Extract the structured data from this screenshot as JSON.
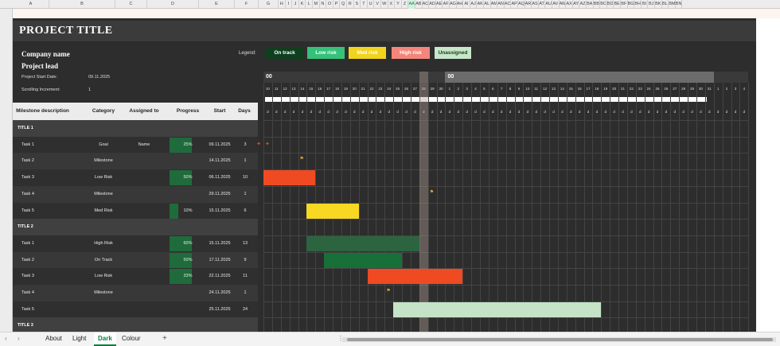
{
  "column_headers": [
    "A",
    "B",
    "C",
    "D",
    "E",
    "F",
    "G",
    "H",
    "I",
    "J",
    "K",
    "L",
    "M",
    "N",
    "O",
    "P",
    "Q",
    "R",
    "S",
    "T",
    "U",
    "V",
    "W",
    "X",
    "Y",
    "Z",
    "AA",
    "AB",
    "AC",
    "AD",
    "AE",
    "AF",
    "AG",
    "AH",
    "AI",
    "AJ",
    "AK",
    "AL",
    "AM",
    "AN",
    "AO",
    "AP",
    "AQ",
    "AR",
    "AS",
    "AT",
    "AU",
    "AV",
    "AW",
    "AX",
    "AY",
    "AZ",
    "BA",
    "BB",
    "BC",
    "BD",
    "BE",
    "BF",
    "BG",
    "BH",
    "BI",
    "BJ",
    "BK",
    "BL",
    "BM",
    "BN"
  ],
  "sheet": {
    "title": "PROJECT TITLE",
    "company": "Company name",
    "project_lead": "Project lead",
    "start_label": "Project Start Date:",
    "start_value": "09.11.2025",
    "scroll_label": "Scrolling Increment:",
    "scroll_value": "1"
  },
  "legend": {
    "label": "Legend:",
    "items": [
      {
        "label": "On track",
        "bg": "#0f3f1f",
        "fg": "#ffffff"
      },
      {
        "label": "Low risk",
        "bg": "#36c17a",
        "fg": "#ffffff"
      },
      {
        "label": "Med risk",
        "bg": "#f2d41f",
        "fg": "#ffffff"
      },
      {
        "label": "High risk",
        "bg": "#f3857a",
        "fg": "#ffffff"
      },
      {
        "label": "Unassigned",
        "bg": "#c8e6c9",
        "fg": "#1a3a1a"
      }
    ]
  },
  "table_headers": {
    "milestone": "Milestone description",
    "category": "Category",
    "assigned": "Assigned to",
    "progress": "Progress",
    "start": "Start",
    "days": "Days"
  },
  "rows": [
    {
      "type": "title",
      "name": "TITLE 1"
    },
    {
      "type": "task",
      "name": "Task 1",
      "category": "Goal",
      "assigned": "Name",
      "progress": "25%",
      "progress_frac": 0.25,
      "start": "09.11.2025",
      "days": "3",
      "marker": "star"
    },
    {
      "type": "task",
      "name": "Task 2",
      "category": "Milestone",
      "assigned": "",
      "progress": "",
      "progress_frac": 0,
      "start": "14.11.2025",
      "days": "1",
      "marker": "flag"
    },
    {
      "type": "task",
      "name": "Task 3",
      "category": "Low Risk",
      "assigned": "",
      "progress": "50%",
      "progress_frac": 0.5,
      "start": "06.11.2025",
      "days": "10",
      "marker": "bar",
      "color": "#f04a23"
    },
    {
      "type": "task",
      "name": "Task 4",
      "category": "Milestone",
      "assigned": "",
      "progress": "",
      "progress_frac": 0,
      "start": "29.11.2025",
      "days": "1",
      "marker": "flag"
    },
    {
      "type": "task",
      "name": "Task 5",
      "category": "Med Risk",
      "assigned": "",
      "progress": "10%",
      "progress_frac": 0.1,
      "start": "15.11.2025",
      "days": "6",
      "marker": "bar",
      "color": "#f8d823"
    },
    {
      "type": "title",
      "name": "TITLE 2"
    },
    {
      "type": "task",
      "name": "Task 1",
      "category": "High Risk",
      "assigned": "",
      "progress": "60%",
      "progress_frac": 0.6,
      "start": "15.11.2025",
      "days": "13",
      "marker": "bar",
      "color": "#2d6440"
    },
    {
      "type": "task",
      "name": "Task 2",
      "category": "On Track",
      "assigned": "",
      "progress": "50%",
      "progress_frac": 0.5,
      "start": "17.11.2025",
      "days": "9",
      "marker": "bar",
      "color": "#167038"
    },
    {
      "type": "task",
      "name": "Task 3",
      "category": "Low Risk",
      "assigned": "",
      "progress": "33%",
      "progress_frac": 0.33,
      "start": "22.11.2025",
      "days": "11",
      "marker": "bar",
      "color": "#f04a23"
    },
    {
      "type": "task",
      "name": "Task 4",
      "category": "Milestone",
      "assigned": "",
      "progress": "",
      "progress_frac": 0,
      "start": "24.11.2025",
      "days": "1",
      "marker": "flag"
    },
    {
      "type": "task",
      "name": "Task 5",
      "category": "",
      "assigned": "",
      "progress": "",
      "progress_frac": 0,
      "start": "25.11.2025",
      "days": "24",
      "marker": "bar",
      "color": "#c5e3c6"
    },
    {
      "type": "title",
      "name": "TITLE 3"
    }
  ],
  "gantt": {
    "month_labels": [
      "00",
      "00"
    ],
    "day_numbers": [
      10,
      11,
      12,
      13,
      14,
      15,
      16,
      17,
      18,
      19,
      20,
      21,
      22,
      23,
      24,
      25,
      26,
      27,
      28,
      29,
      30,
      1,
      2,
      3,
      4,
      5,
      6,
      7,
      8,
      9,
      10,
      11,
      12,
      13,
      14,
      15,
      16,
      17,
      18,
      19,
      20,
      21,
      22,
      23,
      24,
      25,
      26,
      27,
      28,
      29,
      30,
      31,
      1,
      2,
      3,
      4
    ],
    "day_letter": "d",
    "today_day": "28"
  },
  "tabs": {
    "items": [
      "About",
      "Light",
      "Dark",
      "Colour"
    ],
    "active": "Dark",
    "add": "+"
  }
}
